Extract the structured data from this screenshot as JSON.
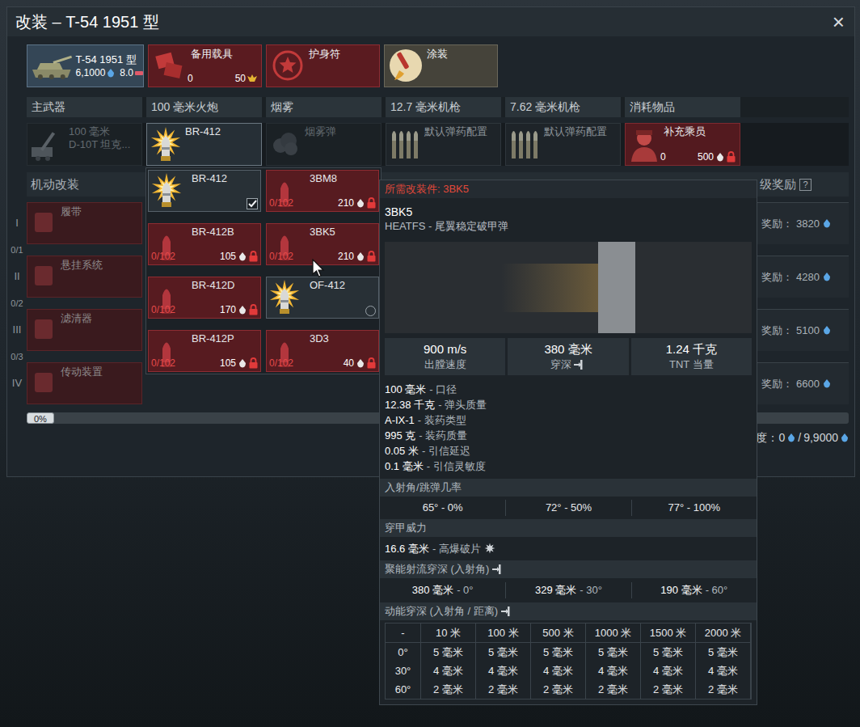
{
  "window": {
    "title": "改装 – T-54 1951 型",
    "close": "×"
  },
  "vehicle": {
    "name": "T-54 1951 型",
    "price": "6,1000",
    "rank": "8.0"
  },
  "slots": [
    {
      "label": "备用载具",
      "count": "0",
      "price": "50",
      "kind": "backup",
      "locked": true
    },
    {
      "label": "护身符",
      "kind": "talisman",
      "locked": true
    },
    {
      "label": "涂装",
      "kind": "paint",
      "locked": false
    }
  ],
  "columns": [
    "主武器",
    "100 毫米火炮",
    "烟雾",
    "12.7 毫米机枪",
    "7.62 毫米机枪",
    "消耗物品"
  ],
  "weapons": [
    {
      "lines": [
        "100 毫米",
        "D-10T 坦克..."
      ],
      "kind": "gun",
      "disabled": true,
      "selected": false,
      "locked": false
    },
    {
      "lines": [
        "BR-412"
      ],
      "kind": "shell",
      "disabled": false,
      "selected": true,
      "locked": false
    },
    {
      "lines": [
        "烟雾弹"
      ],
      "kind": "smoke",
      "disabled": true,
      "selected": false,
      "locked": false
    },
    {
      "lines": [
        "默认弹药配置"
      ],
      "kind": "ammo",
      "disabled": false,
      "selected": false,
      "locked": false
    },
    {
      "lines": [
        "默认弹药配置"
      ],
      "kind": "ammo",
      "disabled": false,
      "selected": false,
      "locked": false
    },
    {
      "lines": [
        "补充乘员"
      ],
      "kind": "crew",
      "count": "0",
      "price": "500",
      "disabled": false,
      "selected": false,
      "locked": true
    }
  ],
  "mobility": {
    "title": "机动改装",
    "tiers": [
      {
        "numeral": "I",
        "item": "履带",
        "count": "0/1"
      },
      {
        "numeral": "II",
        "item": "悬挂系统",
        "count": "0/2"
      },
      {
        "numeral": "III",
        "item": "滤清器",
        "count": "0/3"
      },
      {
        "numeral": "IV",
        "item": "传动装置"
      }
    ]
  },
  "rewards": {
    "title": "级奖励",
    "help": "?",
    "items": [
      {
        "label": "奖励：",
        "value": "3820"
      },
      {
        "label": "奖励：",
        "value": "4280"
      },
      {
        "label": "奖励：",
        "value": "5100"
      },
      {
        "label": "奖励：",
        "value": "6600"
      }
    ]
  },
  "progress": {
    "label": "0%",
    "level": 0
  },
  "research": {
    "label": "度：0",
    "separator": "/",
    "total": "9,9000"
  },
  "dropdown": {
    "items": [
      {
        "name": "BR-412",
        "kind": "checkbox",
        "selected": true,
        "locked": false
      },
      {
        "name": "3BM8",
        "progress": "0/102",
        "price": "210",
        "kind": "locked",
        "selected": false,
        "locked": true
      },
      {
        "name": "BR-412B",
        "progress": "0/102",
        "price": "105",
        "kind": "locked",
        "selected": false,
        "locked": true
      },
      {
        "name": "3BK5",
        "progress": "0/102",
        "price": "210",
        "kind": "locked",
        "selected": false,
        "locked": true
      },
      {
        "name": "BR-412D",
        "progress": "0/102",
        "price": "170",
        "kind": "locked",
        "selected": false,
        "locked": true
      },
      {
        "name": "OF-412",
        "kind": "radio",
        "selected": false,
        "locked": false
      },
      {
        "name": "BR-412P",
        "progress": "0/102",
        "price": "105",
        "kind": "locked",
        "selected": false,
        "locked": true
      },
      {
        "name": "3D3",
        "progress": "0/102",
        "price": "40",
        "kind": "locked",
        "selected": false,
        "locked": true
      }
    ]
  },
  "tooltip": {
    "required": "所需改装件: 3BK5",
    "name": "3BK5",
    "type": "HEATFS - 尾翼稳定破甲弹",
    "stats": [
      {
        "value": "900 m/s",
        "label": "出膛速度",
        "kind": "plain"
      },
      {
        "value": "380 毫米",
        "label": "穿深",
        "kind": "pen"
      },
      {
        "value": "1.24 千克",
        "label": "TNT 当量",
        "kind": "plain"
      }
    ],
    "specs": [
      {
        "value": "100 毫米",
        "label": "- 口径"
      },
      {
        "value": "12.38 千克",
        "label": "- 弹头质量"
      },
      {
        "value": "A-IX-1",
        "label": "- 装药类型"
      },
      {
        "value": "995 克",
        "label": "- 装药质量"
      },
      {
        "value": "0.05 米",
        "label": "- 引信延迟"
      },
      {
        "value": "0.1 毫米",
        "label": "- 引信灵敏度"
      }
    ],
    "ricochet": {
      "title": "入射角/跳弹几率",
      "items": [
        "65° - 0%",
        "72° - 50%",
        "77° - 100%"
      ]
    },
    "power": {
      "title": "穿甲威力",
      "value": "16.6 毫米",
      "label": "- 高爆破片"
    },
    "jet": {
      "title": "聚能射流穿深 (入射角)",
      "items": [
        {
          "value": "380 毫米",
          "label": "- 0°"
        },
        {
          "value": "329 毫米",
          "label": "- 30°"
        },
        {
          "value": "190 毫米",
          "label": "- 60°"
        }
      ]
    },
    "kinetic": {
      "title": "动能穿深 (入射角 / 距离)",
      "corner": "-",
      "distances": [
        "10 米",
        "100 米",
        "500 米",
        "1000 米",
        "1500 米",
        "2000 米"
      ],
      "rows": [
        {
          "angle": "0°",
          "values": [
            "5 毫米",
            "5 毫米",
            "5 毫米",
            "5 毫米",
            "5 毫米",
            "5 毫米"
          ]
        },
        {
          "angle": "30°",
          "values": [
            "4 毫米",
            "4 毫米",
            "4 毫米",
            "4 毫米",
            "4 毫米",
            "4 毫米"
          ]
        },
        {
          "angle": "60°",
          "values": [
            "2 毫米",
            "2 毫米",
            "2 毫米",
            "2 毫米",
            "2 毫米",
            "2 毫米"
          ]
        }
      ]
    }
  }
}
